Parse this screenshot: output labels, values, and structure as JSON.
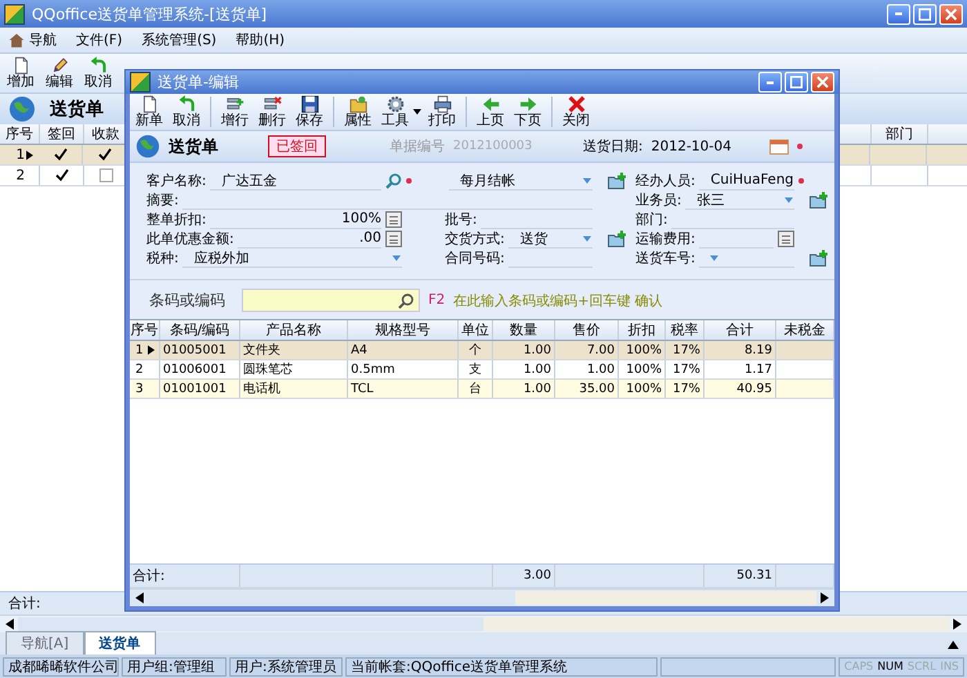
{
  "window": {
    "title": "QQoffice送货单管理系统-[送货单]"
  },
  "menu": [
    {
      "label": "导航"
    },
    {
      "label": "文件(F)"
    },
    {
      "label": "系统管理(S)"
    },
    {
      "label": "帮助(H)"
    }
  ],
  "toolbar": [
    {
      "label": "增加"
    },
    {
      "label": "编辑"
    },
    {
      "label": "取消"
    }
  ],
  "list": {
    "title": "送货单",
    "columns": [
      "序号",
      "签回",
      "收款"
    ],
    "extra_column": "部门",
    "total_label": "合计:",
    "rows": [
      {
        "no": "1",
        "signed": true,
        "paid": true,
        "selected": true
      },
      {
        "no": "2",
        "signed": true,
        "paid": false,
        "selected": false
      }
    ]
  },
  "tabs": [
    {
      "label": "导航[A]",
      "selected": false
    },
    {
      "label": "送货单",
      "selected": true
    }
  ],
  "status_bar": [
    "成都晞晞软件公司",
    "用户组:管理组",
    "用户:系统管理员",
    "当前帐套:QQoffice送货单管理系统"
  ],
  "indicators": [
    {
      "label": "CAPS",
      "on": false
    },
    {
      "label": "NUM",
      "on": true
    },
    {
      "label": "SCRL",
      "on": false
    },
    {
      "label": "INS",
      "on": false
    }
  ],
  "dialog": {
    "title": "送货单-编辑",
    "toolbar": [
      {
        "label": "新单"
      },
      {
        "label": "取消"
      },
      {
        "label": "增行"
      },
      {
        "label": "删行"
      },
      {
        "label": "保存"
      },
      {
        "label": "属性"
      },
      {
        "label": "工具",
        "menu": true
      },
      {
        "label": "打印"
      },
      {
        "label": "上页"
      },
      {
        "label": "下页"
      },
      {
        "label": "关闭"
      }
    ],
    "header": {
      "title": "送货单",
      "stamp": "已签回",
      "number_label": "单据编号",
      "number": "2012100003",
      "number_disabled": true,
      "date_label": "送货日期:",
      "date": "2012-10-04",
      "date_required": true
    },
    "fields": [
      {
        "label": "客户名称:",
        "value": "广达五金",
        "kind": "lookup",
        "required": true,
        "add": false
      },
      {
        "value": "每月结帐",
        "kind": "dropdown",
        "required": false,
        "add": true
      },
      {
        "label": "经办人员:",
        "value": "CuiHuaFeng",
        "kind": "text",
        "required": true,
        "add": false
      },
      {
        "label": "摘要:",
        "kind": "text",
        "wide": true,
        "required": false,
        "add": false
      },
      {
        "label": "业务员:",
        "value": "张三",
        "kind": "dropdown",
        "required": false,
        "add": true
      },
      {
        "label": "整单折扣:",
        "value": "100%",
        "kind": "calc",
        "required": false,
        "add": false
      },
      {
        "label": "批号:",
        "kind": "text",
        "required": false,
        "add": false
      },
      {
        "label": "部门:",
        "kind": "text",
        "required": false,
        "add": false
      },
      {
        "label": "此单优惠金额:",
        "value": ".00",
        "kind": "calc",
        "required": false,
        "add": false
      },
      {
        "label": "交货方式:",
        "value": "送货",
        "kind": "dropdown",
        "required": false,
        "add": true
      },
      {
        "label": "运输费用:",
        "kind": "calc",
        "required": false,
        "add": false
      },
      {
        "label": "税种:",
        "value": "应税外加",
        "kind": "dropdown",
        "required": false,
        "add": false
      },
      {
        "label": "合同号码:",
        "kind": "text",
        "required": false,
        "add": false
      },
      {
        "label": "送货车号:",
        "kind": "dropdown",
        "required": false,
        "add": true
      }
    ],
    "barcode": {
      "label": "条码或编码",
      "hint_key": "F2",
      "hint": "在此输入条码或编码+回车键 确认"
    },
    "table": {
      "columns": [
        "序号",
        "条码/编码",
        "产品名称",
        "规格型号",
        "单位",
        "数量",
        "售价",
        "折扣",
        "税率",
        "合计",
        "未税金"
      ],
      "rows": [
        {
          "cells": [
            "1",
            "01005001",
            "文件夹",
            "A4",
            "个",
            "1.00",
            "7.00",
            "100%",
            "17%",
            "8.19"
          ],
          "selected": true
        },
        {
          "cells": [
            "2",
            "01006001",
            "圆珠笔芯",
            "0.5mm",
            "支",
            "1.00",
            "1.00",
            "100%",
            "17%",
            "1.17"
          ],
          "selected": false
        },
        {
          "cells": [
            "3",
            "01001001",
            "电话机",
            "TCL",
            "台",
            "1.00",
            "35.00",
            "100%",
            "17%",
            "40.95"
          ],
          "selected": false
        }
      ],
      "totals": {
        "label": "合计:",
        "quantity": "3.00",
        "amount": "50.31"
      }
    }
  }
}
